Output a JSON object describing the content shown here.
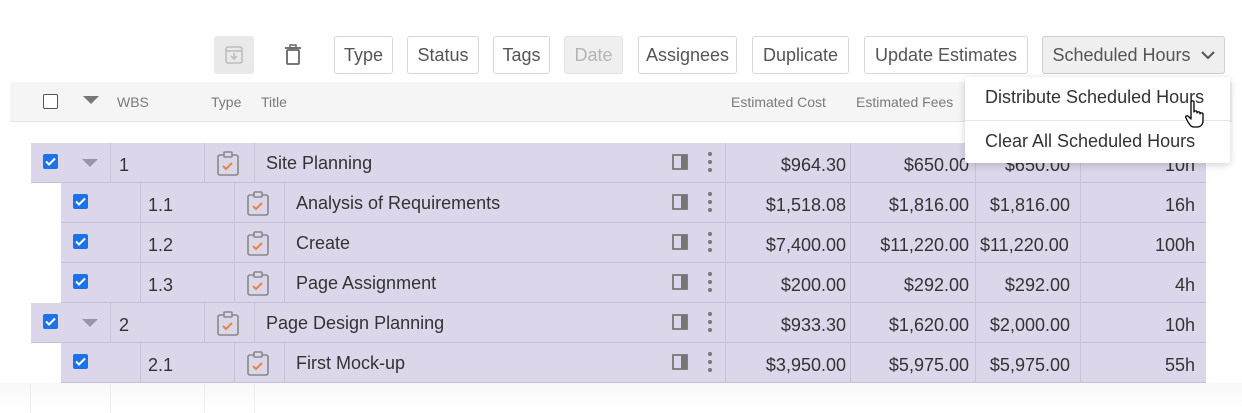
{
  "toolbar": {
    "buttons": [
      {
        "label": "Type"
      },
      {
        "label": "Status"
      },
      {
        "label": "Tags"
      },
      {
        "label": "Date"
      },
      {
        "label": "Assignees"
      },
      {
        "label": "Duplicate"
      },
      {
        "label": "Update Estimates"
      }
    ],
    "dropdown_label": "Scheduled Hours"
  },
  "header": {
    "wbs": "WBS",
    "type": "Type",
    "title": "Title",
    "estimated_cost": "Estimated Cost",
    "estimated_fees": "Estimated Fees"
  },
  "rows": [
    {
      "wbs": "1",
      "title": "Site Planning",
      "cost": "$964.30",
      "fees": "$650.00",
      "col3": "$650.00",
      "hours": "10h"
    },
    {
      "wbs": "1.1",
      "title": "Analysis of Requirements",
      "cost": "$1,518.08",
      "fees": "$1,816.00",
      "col3": "$1,816.00",
      "hours": "16h"
    },
    {
      "wbs": "1.2",
      "title": "Create",
      "cost": "$7,400.00",
      "fees": "$11,220.00",
      "col3": "$11,220.00",
      "hours": "100h"
    },
    {
      "wbs": "1.3",
      "title": "Page Assignment",
      "cost": "$200.00",
      "fees": "$292.00",
      "col3": "$292.00",
      "hours": "4h"
    },
    {
      "wbs": "2",
      "title": "Page Design Planning",
      "cost": "$933.30",
      "fees": "$1,620.00",
      "col3": "$2,000.00",
      "hours": "10h"
    },
    {
      "wbs": "2.1",
      "title": "First Mock-up",
      "cost": "$3,950.00",
      "fees": "$5,975.00",
      "col3": "$5,975.00",
      "hours": "55h"
    }
  ],
  "menu": {
    "items": [
      "Distribute Scheduled Hours",
      "Clear All Scheduled Hours"
    ]
  },
  "colors": {
    "row_bg": "#dcd6ea",
    "checkbox": "#1a73e8",
    "task_icon_accent": "#e8843a"
  },
  "icons": [
    "save-icon",
    "trash-icon",
    "chevron-down-icon",
    "task-icon",
    "panel-icon",
    "kebab-icon",
    "checkbox-checked",
    "checkbox-empty",
    "caret-down-icon",
    "hand-cursor-icon"
  ]
}
